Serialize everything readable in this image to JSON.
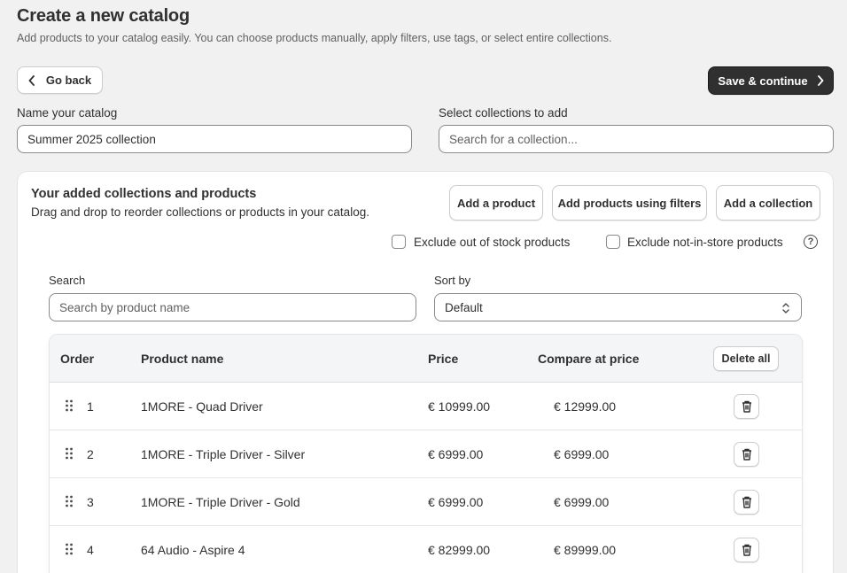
{
  "page": {
    "title": "Create a new catalog",
    "subtitle": "Add products to your catalog easily. You can choose products manually, apply filters, use tags, or select entire collections."
  },
  "actions": {
    "back_label": "Go back",
    "save_label": "Save & continue"
  },
  "catalog_name": {
    "label": "Name your catalog",
    "value": "Summer 2025 collection"
  },
  "collections": {
    "label": "Select collections to add",
    "placeholder": "Search for a collection..."
  },
  "card": {
    "title": "Your added collections and products",
    "subtitle": "Drag and drop to reorder collections or products in your catalog.",
    "buttons": {
      "add_product": "Add a product",
      "add_filters": "Add products using filters",
      "add_collection": "Add a collection"
    },
    "checkboxes": {
      "exclude_out_of_stock": "Exclude out of stock products",
      "exclude_not_in_store": "Exclude not-in-store products"
    },
    "search": {
      "label": "Search",
      "placeholder": "Search by product name"
    },
    "sort": {
      "label": "Sort by",
      "value": "Default"
    }
  },
  "table": {
    "headers": {
      "order": "Order",
      "name": "Product name",
      "price": "Price",
      "compare": "Compare at price",
      "delete_all": "Delete all"
    },
    "rows": [
      {
        "order": "1",
        "name": "1MORE - Quad Driver",
        "price": "€ 10999.00",
        "compare": "€ 12999.00"
      },
      {
        "order": "2",
        "name": "1MORE - Triple Driver - Silver",
        "price": "€ 6999.00",
        "compare": "€ 6999.00"
      },
      {
        "order": "3",
        "name": "1MORE - Triple Driver - Gold",
        "price": "€ 6999.00",
        "compare": "€ 6999.00"
      },
      {
        "order": "4",
        "name": "64 Audio - Aspire 4",
        "price": "€ 82999.00",
        "compare": "€ 89999.00"
      }
    ]
  },
  "icons": {
    "back": "chevron-left-icon",
    "save": "chevron-right-icon",
    "help": "question-circle-icon",
    "drag": "drag-handle-icon",
    "delete": "trash-icon",
    "sort": "select-arrows-icon"
  }
}
